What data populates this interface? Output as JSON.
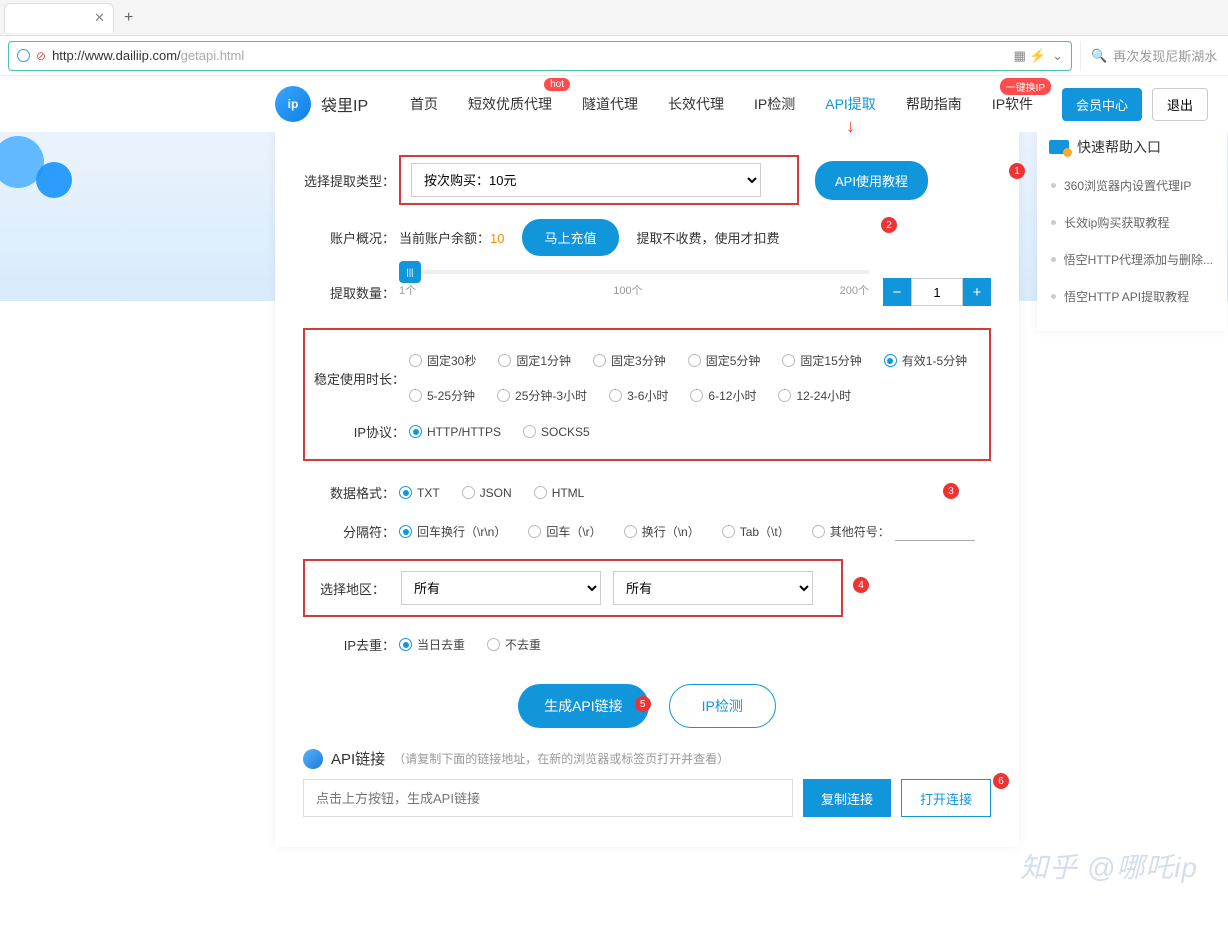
{
  "browser": {
    "url_host": "http://www.dailiip.com/",
    "url_path": "getapi.html",
    "search_placeholder": "再次发现尼斯湖水"
  },
  "header": {
    "logo_text": "袋里IP",
    "nav": {
      "home": "首页",
      "short_proxy": "短效优质代理",
      "tunnel_proxy": "隧道代理",
      "long_proxy": "长效代理",
      "ip_detect": "IP检测",
      "api_extract": "API提取",
      "help": "帮助指南",
      "ip_software": "IP软件"
    },
    "hot_badge": "hot",
    "soft_badge": "一键换IP",
    "member_btn": "会员中心",
    "logout_btn": "退出"
  },
  "form": {
    "type_label": "选择提取类型：",
    "type_value": "按次购买：10元",
    "api_tutorial_btn": "API使用教程",
    "account_label": "账户概况：",
    "balance_prefix": "当前账户余额：",
    "balance_value": "10",
    "recharge_btn": "马上充值",
    "fee_note": "提取不收费，使用才扣费",
    "qty_label": "提取数量：",
    "qty_value": "1",
    "slider_ticks": {
      "t1": "1个",
      "t2": "100个",
      "t3": "200个"
    },
    "duration_label": "稳定使用时长：",
    "durations": {
      "d30s": "固定30秒",
      "d1m": "固定1分钟",
      "d3m": "固定3分钟",
      "d5m": "固定5分钟",
      "d15m": "固定15分钟",
      "d1_5": "有效1-5分钟",
      "d5_25": "5-25分钟",
      "d25_3h": "25分钟-3小时",
      "d3_6": "3-6小时",
      "d6_12": "6-12小时",
      "d12_24": "12-24小时"
    },
    "protocol_label": "IP协议：",
    "protocols": {
      "http": "HTTP/HTTPS",
      "socks5": "SOCKS5"
    },
    "format_label": "数据格式：",
    "formats": {
      "txt": "TXT",
      "json": "JSON",
      "html": "HTML"
    },
    "sep_label": "分隔符：",
    "seps": {
      "crlf": "回车换行（\\r\\n）",
      "cr": "回车（\\r）",
      "lf": "换行（\\n）",
      "tab": "Tab（\\t）",
      "other": "其他符号："
    },
    "region_label": "选择地区：",
    "region_all1": "所有",
    "region_all2": "所有",
    "dedup_label": "IP去重：",
    "dedup": {
      "daily": "当日去重",
      "none": "不去重"
    },
    "gen_btn": "生成API链接",
    "detect_btn": "IP检测",
    "api_link_title": "API链接",
    "api_link_hint": "（请复制下面的链接地址，在新的浏览器或标签页打开并查看）",
    "link_placeholder": "点击上方按钮，生成API链接",
    "copy_btn": "复制连接",
    "open_btn": "打开连接"
  },
  "sidebar": {
    "title": "快速帮助入口",
    "items": {
      "i1": "360浏览器内设置代理IP",
      "i2": "长效ip购买获取教程",
      "i3": "悟空HTTP代理添加与删除...",
      "i4": "悟空HTTP API提取教程"
    }
  },
  "markers": {
    "m1": "1",
    "m2": "2",
    "m3": "3",
    "m4": "4",
    "m5": "5",
    "m6": "6"
  },
  "watermark": "知乎 @哪吒ip"
}
